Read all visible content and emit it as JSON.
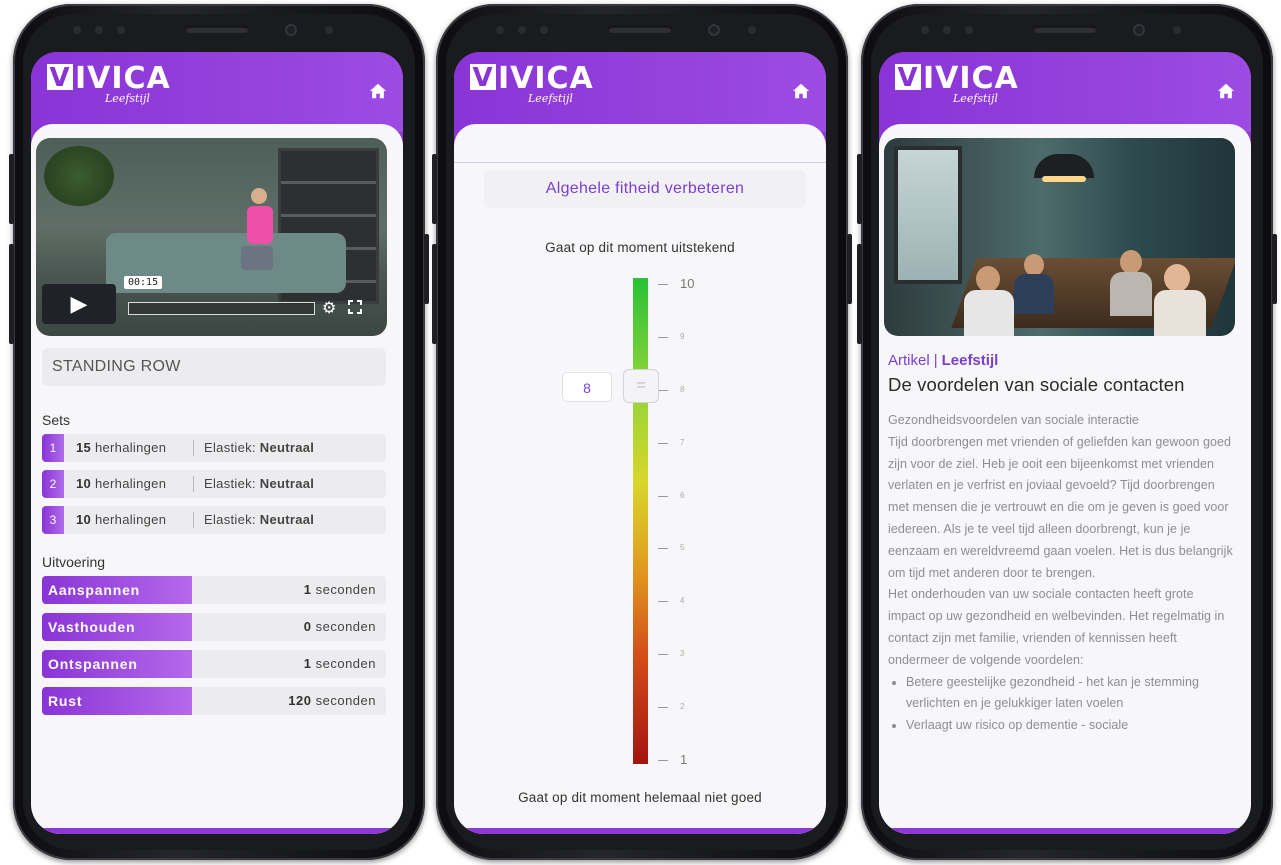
{
  "brand": {
    "name": "IVICA",
    "initial": "V",
    "tagline": "Leefstijl"
  },
  "colors": {
    "accent": "#8c39d6",
    "accent_text": "#7b3fcf",
    "bar_bg": "#ececef"
  },
  "phone1": {
    "video": {
      "time": "00:15",
      "play_icon": "▶",
      "settings_icon": "⚙",
      "fullscreen_icon": "⛶"
    },
    "exercise_title": "STANDING ROW",
    "sets_label": "Sets",
    "sets": [
      {
        "num": "1",
        "reps": "15",
        "reps_unit": "herhalingen",
        "elastic_label": "Elastiek:",
        "elastic_value": "Neutraal"
      },
      {
        "num": "2",
        "reps": "10",
        "reps_unit": "herhalingen",
        "elastic_label": "Elastiek:",
        "elastic_value": "Neutraal"
      },
      {
        "num": "3",
        "reps": "10",
        "reps_unit": "herhalingen",
        "elastic_label": "Elastiek:",
        "elastic_value": "Neutraal"
      }
    ],
    "execution_label": "Uitvoering",
    "execution": [
      {
        "label": "Aanspannen",
        "value": "1",
        "unit": "seconden"
      },
      {
        "label": "Vasthouden",
        "value": "0",
        "unit": "seconden"
      },
      {
        "label": "Ontspannen",
        "value": "1",
        "unit": "seconden"
      },
      {
        "label": "Rust",
        "value": "120",
        "unit": "seconden"
      }
    ]
  },
  "phone2": {
    "goal": "Algehele fitheid verbeteren",
    "top_label": "Gaat op dit moment uitstekend",
    "bottom_label": "Gaat op dit moment helemaal niet goed",
    "scale": {
      "min": 1,
      "max": 10,
      "value": 8,
      "value_text": "8",
      "max_text": "10",
      "min_text": "1",
      "ticks": [
        "10",
        "9",
        "8",
        "7",
        "6",
        "5",
        "4",
        "3",
        "2",
        "1"
      ]
    },
    "handle_glyph": "="
  },
  "phone3": {
    "category": "Artikel",
    "category_sep": "|",
    "subcategory": "Leefstijl",
    "title": "De voordelen van sociale contacten",
    "body": {
      "line1": "Gezondheidsvoordelen van sociale interactie",
      "para1": "Tijd doorbrengen met vrienden of geliefden kan gewoon goed zijn voor de ziel. Heb je ooit een bijeenkomst met vrienden verlaten en je verfrist en joviaal gevoeld? Tijd doorbrengen met mensen die je vertrouwt en die om je geven is goed voor iedereen. Als je te veel tijd alleen doorbrengt, kun je je eenzaam en wereldvreemd gaan voelen. Het is dus belangrijk om tijd met anderen door te brengen.",
      "para2": "Het onderhouden van uw sociale contacten heeft grote impact op uw gezondheid en welbevinden. Het regelmatig in contact zijn met familie, vrienden of kennissen heeft ondermeer de volgende voordelen:",
      "bullets": [
        "Betere geestelijke gezondheid - het kan je stemming verlichten en je gelukkiger laten voelen",
        "Verlaagt uw risico op dementie - sociale"
      ]
    }
  },
  "icons": {
    "home": "home-icon"
  }
}
